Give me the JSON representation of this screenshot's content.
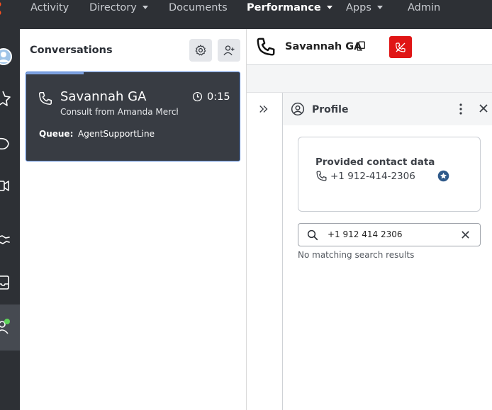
{
  "nav": {
    "items": [
      {
        "label": "Activity",
        "has_caret": false,
        "active": false
      },
      {
        "label": "Directory",
        "has_caret": true,
        "active": false
      },
      {
        "label": "Documents",
        "has_caret": false,
        "active": false
      },
      {
        "label": "Performance",
        "has_caret": true,
        "active": true
      },
      {
        "label": "Apps",
        "has_caret": true,
        "active": false
      },
      {
        "label": "Admin",
        "has_caret": false,
        "active": false
      }
    ]
  },
  "rail": {
    "icons": [
      "avatar-icon",
      "star-icon",
      "chat-bubble-icon",
      "video-icon",
      "handshake-icon",
      "inbox-icon",
      "agent-status-icon"
    ]
  },
  "conversations": {
    "title": "Conversations",
    "settings_icon": "gear-icon",
    "add_icon": "add-user-icon",
    "card": {
      "name": "Savannah GA",
      "timer": "0:15",
      "subtitle": "Consult from Amanda Merchant",
      "queue_label": "Queue:",
      "queue_value": "AgentSupportLine",
      "progress": 0.27
    }
  },
  "interaction": {
    "title": "Savannah GA",
    "copy_icon": "copy-icon",
    "end_call_icon": "end-call-icon"
  },
  "profile": {
    "title": "Profile",
    "contact_card_title": "Provided contact data",
    "contact_phone": "+1 912-414-2306",
    "search_value": "+1 912 414 2306",
    "no_results": "No matching search results"
  },
  "colors": {
    "nav_bg": "#2d3035",
    "card_bg": "#383c43",
    "card_border": "#4a7ed6",
    "end_call": "#e01515",
    "brand": "#ff4f1f",
    "status_green": "#5fd35a"
  }
}
